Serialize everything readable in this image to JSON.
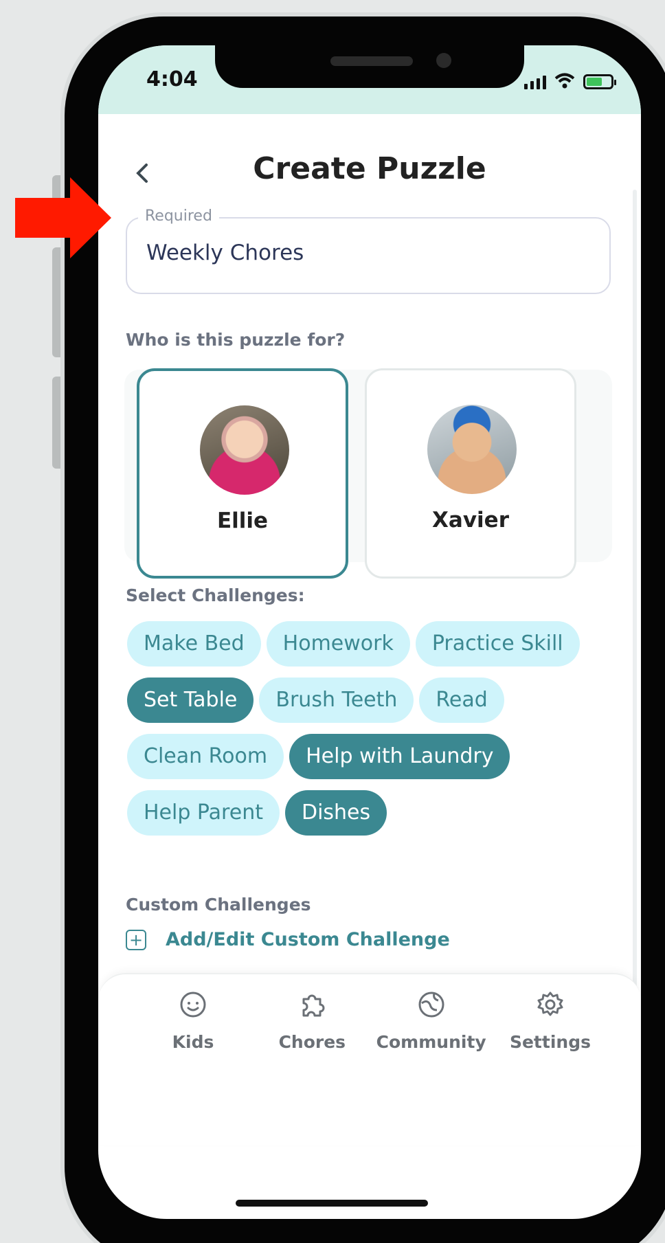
{
  "status": {
    "time": "4:04"
  },
  "header": {
    "back_icon": "chevron-left-icon",
    "title": "Create Puzzle"
  },
  "name_field": {
    "label": "Required",
    "value": "Weekly Chores"
  },
  "kids_section": {
    "label": "Who is this puzzle for?",
    "kids": [
      {
        "name": "Ellie",
        "selected": true
      },
      {
        "name": "Xavier",
        "selected": false
      }
    ]
  },
  "challenges_section": {
    "label": "Select Challenges:",
    "chips": [
      {
        "label": "Make Bed",
        "selected": false
      },
      {
        "label": "Homework",
        "selected": false
      },
      {
        "label": "Practice Skill",
        "selected": false
      },
      {
        "label": "Set Table",
        "selected": true
      },
      {
        "label": "Brush Teeth",
        "selected": false
      },
      {
        "label": "Read",
        "selected": false
      },
      {
        "label": "Clean Room",
        "selected": false
      },
      {
        "label": "Help with Laundry",
        "selected": true
      },
      {
        "label": "Help Parent",
        "selected": false
      },
      {
        "label": "Dishes",
        "selected": true
      }
    ]
  },
  "custom_section": {
    "label": "Custom Challenges",
    "add_label": "Add/Edit Custom Challenge"
  },
  "tabbar": {
    "tabs": [
      {
        "label": "Kids",
        "icon": "smiley-icon"
      },
      {
        "label": "Chores",
        "icon": "puzzle-icon"
      },
      {
        "label": "Community",
        "icon": "globe-icon"
      },
      {
        "label": "Settings",
        "icon": "gear-icon"
      }
    ]
  },
  "colors": {
    "accent": "#3b8891",
    "chip_bg": "#cff4fb",
    "status_bg": "#d3f0ea",
    "arrow": "#ff1a00"
  }
}
